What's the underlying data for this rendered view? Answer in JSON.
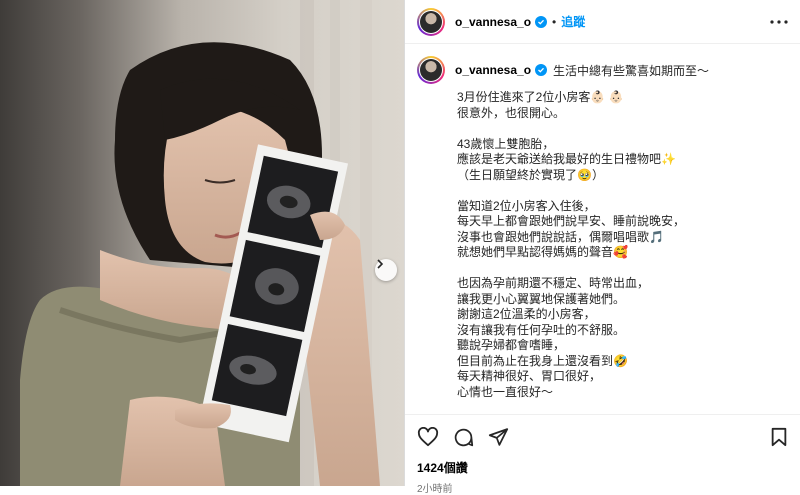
{
  "post": {
    "username": "o_vannesa_o",
    "follow_label": "追蹤",
    "separator": "•",
    "caption_title": "生活中總有些驚喜如期而至～",
    "caption_body": "3月份住進來了2位小房客👶🏻 👶🏻\n很意外，也很開心。\n\n43歲懷上雙胞胎，\n應該是老天爺送給我最好的生日禮物吧✨\n（生日願望終於實現了🥹）\n\n當知道2位小房客入住後，\n每天早上都會跟她們說早安、睡前說晚安，\n沒事也會跟她們說說話，偶爾唱唱歌🎵\n就想她們早點認得媽媽的聲音🥰\n\n也因為孕前期還不穩定、時常出血，\n讓我更小心翼翼地保護著她們。\n謝謝這2位溫柔的小房客，\n沒有讓我有任何孕吐的不舒服。\n聽說孕婦都會嗜睡，\n但目前為止在我身上還沒看到🤣\n每天精神很好、胃口很好，\n心情也一直很好～\n\n沒有想過自己如此幸運，",
    "likes": "1424個讚",
    "time": "2小時前"
  },
  "icons": {
    "more": "more-horizontal-icon",
    "like": "heart-icon",
    "comment": "comment-icon",
    "share": "share-icon",
    "save": "bookmark-icon",
    "next": "chevron-right-icon",
    "verified": "verified-badge-icon"
  },
  "colors": {
    "accent": "#0095f6",
    "text": "#262626",
    "muted": "#737373"
  }
}
